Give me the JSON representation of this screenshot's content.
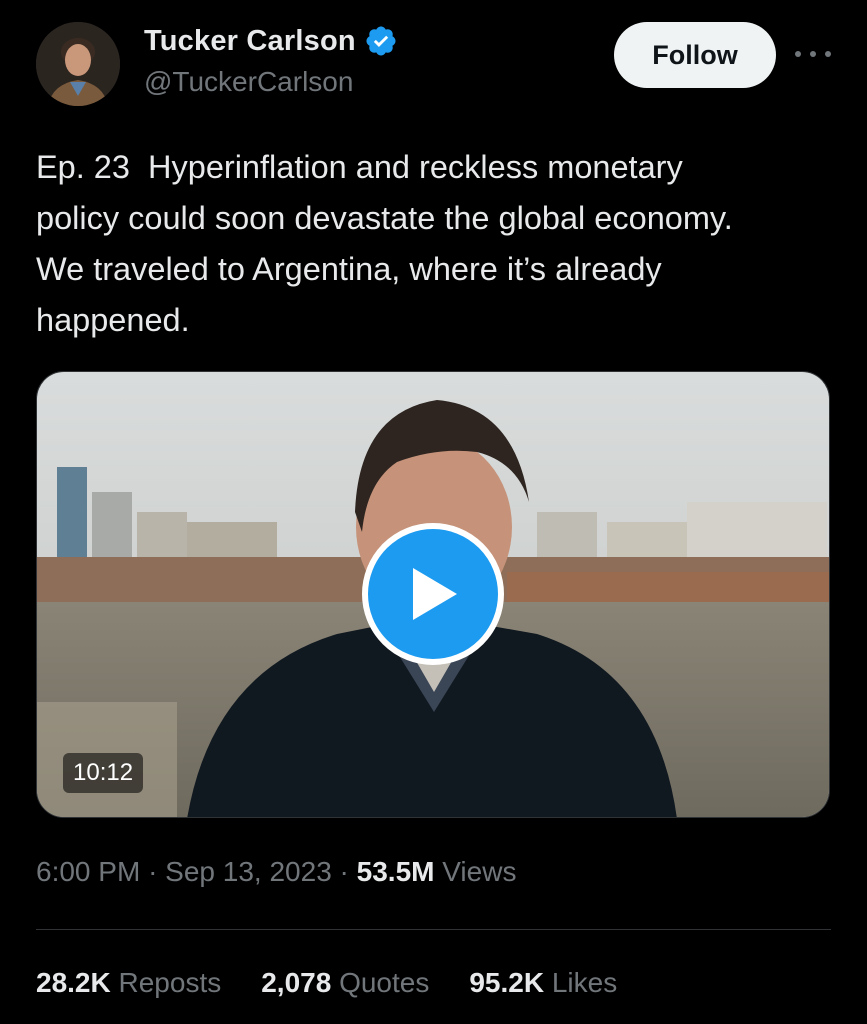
{
  "author": {
    "display_name": "Tucker Carlson",
    "handle": "@TuckerCarlson",
    "verified": true,
    "verified_color": "#1d9bf0",
    "avatar": "profile-photo"
  },
  "actions": {
    "follow_label": "Follow",
    "more_icon": "ellipsis-horizontal-icon"
  },
  "tweet": {
    "text": "Ep. 23  Hyperinflation and reckless monetary\npolicy could soon devastate the global economy.\nWe traveled to Argentina, where it’s already\nhappened."
  },
  "media": {
    "type": "video",
    "duration": "10:12",
    "play_icon": "play-icon",
    "accent_color": "#1d9bf0"
  },
  "meta": {
    "time": "6:00 PM",
    "separator": "·",
    "date": "Sep 13, 2023",
    "views_count": "53.5M",
    "views_label": "Views"
  },
  "stats": {
    "reposts_count": "28.2K",
    "reposts_label": "Reposts",
    "quotes_count": "2,078",
    "quotes_label": "Quotes",
    "likes_count": "95.2K",
    "likes_label": "Likes"
  },
  "colors": {
    "background": "#000000",
    "primary_text": "#e7e9ea",
    "secondary_text": "#71767b",
    "divider": "#2f3336",
    "follow_bg": "#eff3f4"
  }
}
